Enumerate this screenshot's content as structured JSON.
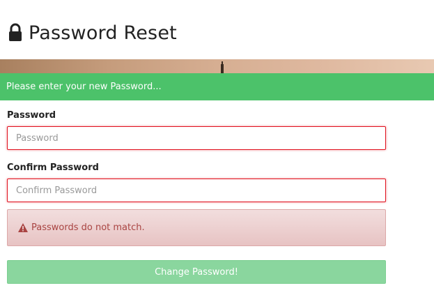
{
  "header": {
    "title": "Password Reset",
    "icon": "lock-icon"
  },
  "info_alert": {
    "text": "Please enter your new Password..."
  },
  "form": {
    "password_label": "Password",
    "password_placeholder": "Password",
    "password_value": "",
    "confirm_label": "Confirm Password",
    "confirm_placeholder": "Confirm Password",
    "confirm_value": ""
  },
  "error_alert": {
    "icon": "warning-icon",
    "text": "Passwords do not match."
  },
  "submit": {
    "label": "Change Password!"
  },
  "colors": {
    "success_green": "#4cc26a",
    "error_red": "#e0121f",
    "error_text": "#a94442",
    "button_green": "#8ad69e"
  }
}
